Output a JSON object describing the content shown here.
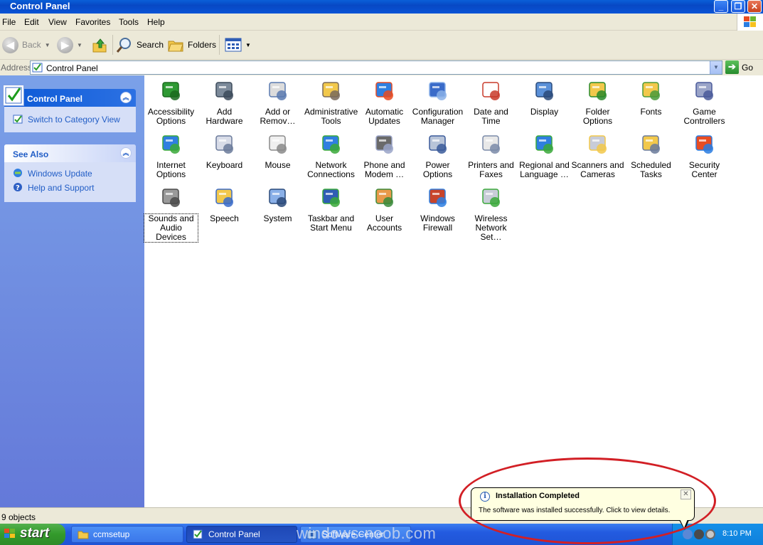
{
  "window": {
    "title": "Control Panel",
    "buttons": {
      "minimize": "_",
      "maximize": "❐",
      "close": "✕"
    }
  },
  "menubar": [
    "File",
    "Edit",
    "View",
    "Favorites",
    "Tools",
    "Help"
  ],
  "toolbar": {
    "back": "Back",
    "search": "Search",
    "folders": "Folders"
  },
  "address": {
    "label": "Address",
    "value": "Control Panel",
    "go": "Go"
  },
  "sidebar": {
    "panel_title": "Control Panel",
    "switch_view": "Switch to Category View",
    "see_also_title": "See Also",
    "see_also": [
      "Windows Update",
      "Help and Support"
    ]
  },
  "items": [
    {
      "label": "Accessibility Options",
      "icon": "accessibility-icon"
    },
    {
      "label": "Add Hardware",
      "icon": "add-hardware-icon"
    },
    {
      "label": "Add or Remov…",
      "icon": "add-remove-programs-icon"
    },
    {
      "label": "Administrative Tools",
      "icon": "administrative-tools-icon"
    },
    {
      "label": "Automatic Updates",
      "icon": "automatic-updates-icon"
    },
    {
      "label": "Configuration Manager",
      "icon": "configuration-manager-icon"
    },
    {
      "label": "Date and Time",
      "icon": "date-time-icon"
    },
    {
      "label": "Display",
      "icon": "display-icon"
    },
    {
      "label": "Folder Options",
      "icon": "folder-options-icon"
    },
    {
      "label": "Fonts",
      "icon": "fonts-icon"
    },
    {
      "label": "Game Controllers",
      "icon": "game-controllers-icon"
    },
    {
      "label": "Internet Options",
      "icon": "internet-options-icon"
    },
    {
      "label": "Keyboard",
      "icon": "keyboard-icon"
    },
    {
      "label": "Mouse",
      "icon": "mouse-icon"
    },
    {
      "label": "Network Connections",
      "icon": "network-connections-icon"
    },
    {
      "label": "Phone and Modem …",
      "icon": "phone-modem-icon"
    },
    {
      "label": "Power Options",
      "icon": "power-options-icon"
    },
    {
      "label": "Printers and Faxes",
      "icon": "printers-faxes-icon"
    },
    {
      "label": "Regional and Language …",
      "icon": "regional-language-icon"
    },
    {
      "label": "Scanners and Cameras",
      "icon": "scanners-cameras-icon"
    },
    {
      "label": "Scheduled Tasks",
      "icon": "scheduled-tasks-icon"
    },
    {
      "label": "Security Center",
      "icon": "security-center-icon"
    },
    {
      "label": "Sounds and Audio Devices",
      "icon": "sounds-audio-icon",
      "selected": true
    },
    {
      "label": "Speech",
      "icon": "speech-icon"
    },
    {
      "label": "System",
      "icon": "system-icon"
    },
    {
      "label": "Taskbar and Start Menu",
      "icon": "taskbar-start-menu-icon"
    },
    {
      "label": "User Accounts",
      "icon": "user-accounts-icon"
    },
    {
      "label": "Windows Firewall",
      "icon": "windows-firewall-icon"
    },
    {
      "label": "Wireless Network Set…",
      "icon": "wireless-network-icon"
    }
  ],
  "status": "9 objects",
  "taskbar": {
    "start": "start",
    "tasks": [
      "ccmsetup",
      "Control Panel",
      "Software Center"
    ],
    "clock": "8:10 PM"
  },
  "watermark": "windows-noob.com",
  "balloon": {
    "title": "Installation Completed",
    "text": "The software was installed successfully. Click to view details.",
    "close": "✕"
  },
  "colors": {
    "titlebar": "#0a5fd8",
    "sidebar": "#7ba1e8",
    "link": "#215dc6",
    "annotation": "#d21f25",
    "balloon_bg": "#ffffe1"
  }
}
